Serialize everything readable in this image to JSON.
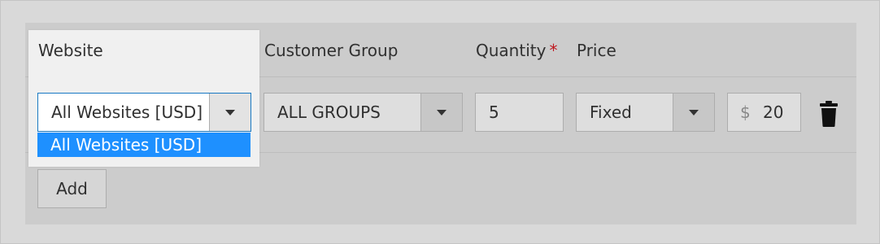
{
  "headers": {
    "website": "Website",
    "customer_group": "Customer Group",
    "quantity": "Quantity",
    "required_mark": "*",
    "price": "Price"
  },
  "row": {
    "website_value": "All Websites [USD]",
    "website_options": [
      "All Websites [USD]"
    ],
    "customer_group_value": "ALL GROUPS",
    "quantity_value": "5",
    "price_type_value": "Fixed",
    "currency_symbol": "$",
    "price_value": "20"
  },
  "actions": {
    "add_label": "Add",
    "delete_icon": "trash-icon"
  },
  "colors": {
    "panel_bg": "#cccccc",
    "selected_option_bg": "#1e90ff",
    "required_mark": "#c0171e",
    "active_border": "#1979c3"
  }
}
